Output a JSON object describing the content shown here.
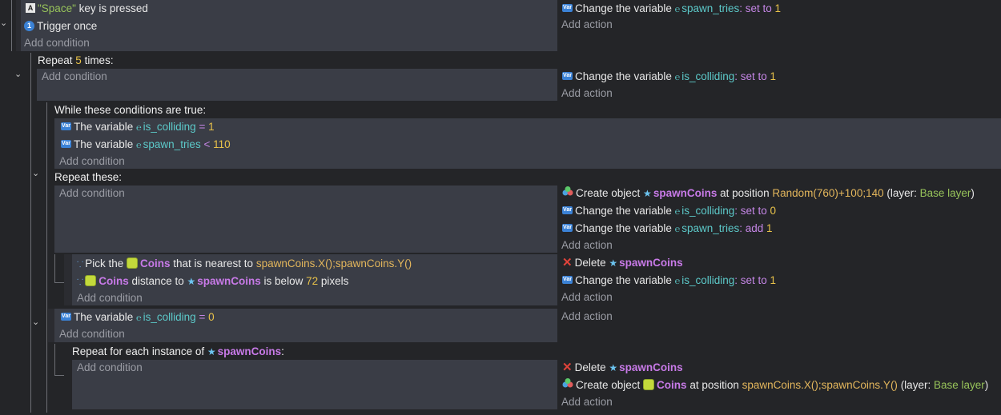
{
  "event1": {
    "key_pre": "\"Space\"",
    "key_post": " key is pressed",
    "trigger_once": "Trigger once",
    "add_condition": "Add condition",
    "action1": {
      "label": "Change the variable ",
      "var": "spawn_tries",
      "op": ": set to ",
      "value": "1"
    },
    "add_action": "Add action"
  },
  "repeat5": {
    "header_pre": "Repeat ",
    "count": "5",
    "header_post": " times:",
    "add_condition": "Add condition",
    "action1": {
      "label": "Change the variable ",
      "var": "is_colliding",
      "op": ": set to ",
      "value": "1"
    },
    "add_action": "Add action"
  },
  "while": {
    "header": "While these conditions are true:",
    "cond1": {
      "label": "The variable ",
      "var": "is_colliding",
      "op": " = ",
      "value": "1"
    },
    "cond2": {
      "label": "The variable ",
      "var": "spawn_tries",
      "op": " < ",
      "value": "110"
    },
    "add_condition": "Add condition",
    "repeat_these": "Repeat these:",
    "add_condition2": "Add condition",
    "action1": {
      "label": "Create object ",
      "obj": "spawnCoins",
      "mid": " at position ",
      "expr": "Random(760)+100;140",
      "l1": " (layer: ",
      "layer": "Base layer",
      "l2": ")"
    },
    "action2": {
      "label": "Change the variable ",
      "var": "is_colliding",
      "op": ": set to ",
      "value": "0"
    },
    "action3": {
      "label": "Change the variable ",
      "var": "spawn_tries",
      "op": ": add ",
      "value": "1"
    },
    "add_action": "Add action"
  },
  "pick": {
    "cond1": {
      "label": "Pick the ",
      "obj": "Coins",
      "mid": " that is nearest to ",
      "expr": "spawnCoins.X();spawnCoins.Y()"
    },
    "cond2": {
      "obj": "Coins",
      "mid": " distance to ",
      "obj2": "spawnCoins",
      "mid2": " is below ",
      "value": "72",
      "post": " pixels"
    },
    "add_condition": "Add condition",
    "action1": {
      "label": "Delete ",
      "obj": "spawnCoins"
    },
    "action2": {
      "label": "Change the variable ",
      "var": "is_colliding",
      "op": ": set to ",
      "value": "1"
    },
    "add_action": "Add action"
  },
  "after": {
    "cond1": {
      "label": "The variable ",
      "var": "is_colliding",
      "op": " = ",
      "value": "0"
    },
    "add_condition": "Add condition",
    "add_action": "Add action"
  },
  "foreach": {
    "header_pre": "Repeat for each instance of ",
    "obj": "spawnCoins",
    "header_post": ":",
    "add_condition": "Add condition",
    "action1": {
      "label": "Delete ",
      "obj": "spawnCoins"
    },
    "action2": {
      "label": "Create object ",
      "obj": "Coins",
      "mid": " at position ",
      "expr": "spawnCoins.X();spawnCoins.Y()",
      "l1": " (layer: ",
      "layer": "Base layer",
      "l2": ")"
    },
    "add_action": "Add action"
  },
  "icons": {
    "key": "A",
    "once": "1",
    "var": "Var",
    "star": "★",
    "delete": "✕",
    "chevron": "⌄",
    "vref": "℮",
    "pick": "⸪"
  },
  "colors": {
    "variable": "#5cc9c9",
    "operator": "#c586e6",
    "number": "#e8c24a",
    "object": "#c87ae8",
    "expression": "#e3b65c",
    "layer": "#97c35a",
    "condition_bg": "#3a3d46"
  }
}
